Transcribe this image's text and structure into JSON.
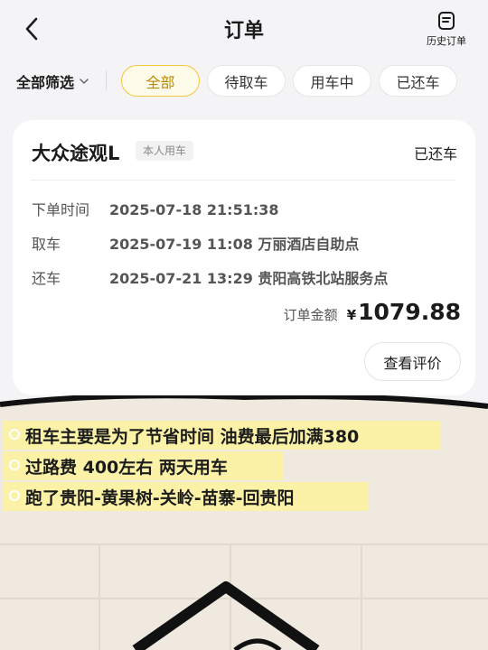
{
  "header": {
    "title": "订单",
    "history_label": "历史订单"
  },
  "filters": {
    "all_filter_label": "全部筛选",
    "tabs": [
      {
        "label": "全部",
        "active": true
      },
      {
        "label": "待取车",
        "active": false
      },
      {
        "label": "用车中",
        "active": false
      },
      {
        "label": "已还车",
        "active": false
      }
    ]
  },
  "order": {
    "car_name": "大众途观L",
    "tag": "本人用车",
    "status": "已还车",
    "details": [
      {
        "key": "下单时间",
        "value": "2025-07-18 21:51:38"
      },
      {
        "key": "取车",
        "value": "2025-07-19 11:08 万丽酒店自助点"
      },
      {
        "key": "还车",
        "value": "2025-07-21 13:29 贵阳高铁北站服务点"
      }
    ],
    "amount_label": "订单金额",
    "currency": "¥",
    "amount": "1079.88",
    "review_button": "查看评价"
  },
  "notes": [
    "租车主要是为了节省时间 油费最后加满380",
    "过路费 400左右 两天用车",
    "跑了贵阳-黄果树-关岭-苗寨-回贵阳"
  ],
  "colors": {
    "accent": "#f5c73a",
    "highlight": "#fbf2a8",
    "background": "#f4f4f6"
  }
}
